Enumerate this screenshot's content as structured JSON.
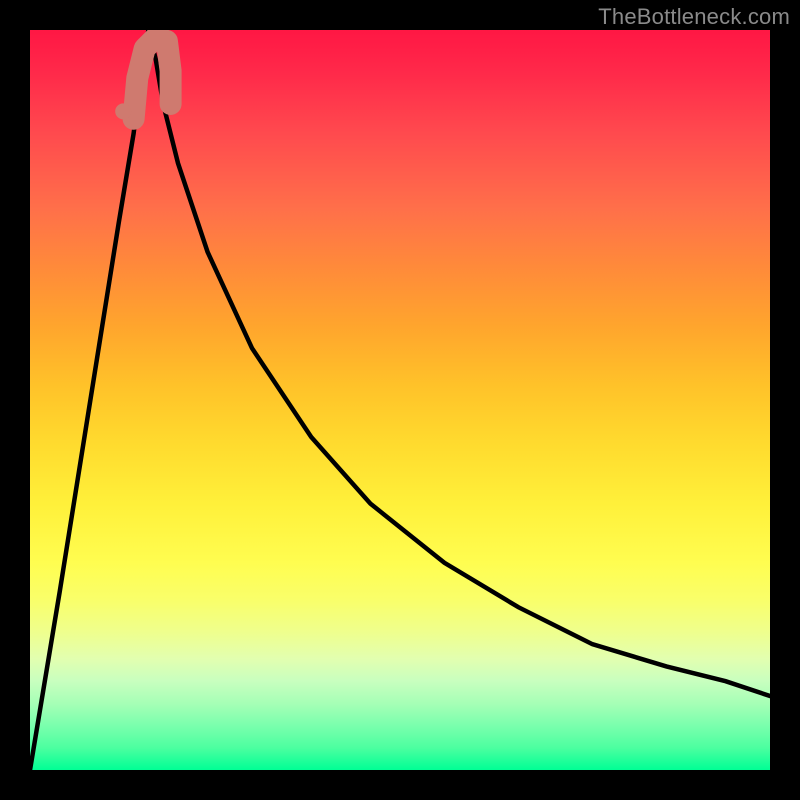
{
  "watermark": "TheBottleneck.com",
  "colors": {
    "background": "#000000",
    "curve_stroke": "#000000",
    "marker_fill": "#cf7a6f"
  },
  "chart_data": {
    "type": "line",
    "title": "",
    "xlabel": "",
    "ylabel": "",
    "xlim": [
      0,
      100
    ],
    "ylim": [
      0,
      100
    ],
    "grid": false,
    "legend": false,
    "note": "Y-axis is inverted visually (0 at top, 100 at bottom). Values estimated from pixel positions; curve is a V-shaped bottleneck plot with minimum near x≈16.",
    "series": [
      {
        "name": "bottleneck-curve",
        "x": [
          0,
          4,
          8,
          12,
          14,
          15,
          16,
          17,
          18,
          20,
          24,
          30,
          38,
          46,
          56,
          66,
          76,
          86,
          94,
          100
        ],
        "y": [
          0,
          24,
          49,
          74,
          86,
          94,
          100,
          96,
          90,
          82,
          70,
          57,
          45,
          36,
          28,
          22,
          17,
          14,
          12,
          10
        ]
      }
    ],
    "marker": {
      "name": "highlight-J",
      "points_xy": [
        [
          14.0,
          88.0
        ],
        [
          14.5,
          93.5
        ],
        [
          15.5,
          97.5
        ],
        [
          17.0,
          99.0
        ],
        [
          18.5,
          98.5
        ],
        [
          19.0,
          94.5
        ],
        [
          19.0,
          90.0
        ]
      ],
      "dot_xy": [
        12.6,
        89.0
      ]
    }
  }
}
